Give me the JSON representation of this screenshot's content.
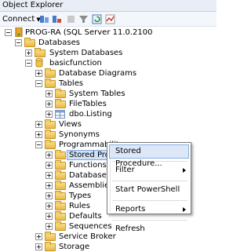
{
  "window": {
    "title": "Object Explorer"
  },
  "toolbar": {
    "connect_label": "Connect"
  },
  "tree": {
    "server": "PROG-RA (SQL Server 11.0.2100",
    "databases": "Databases",
    "system_databases": "System Databases",
    "basicfunction": "basicfunction",
    "database_diagrams": "Database Diagrams",
    "tables": "Tables",
    "system_tables": "System Tables",
    "filetables": "FileTables",
    "dbo_listing": "dbo.Listing",
    "views": "Views",
    "synonyms": "Synonyms",
    "programmability": "Programmability",
    "stored_procedures": "Stored Procedu",
    "functions": "Functions",
    "database_triggers": "Database Tr",
    "assemblies": "Assemblies",
    "types": "Types",
    "rules": "Rules",
    "defaults": "Defaults",
    "sequences": "Sequences",
    "service_broker": "Service Broker",
    "storage": "Storage"
  },
  "context_menu": {
    "items": [
      {
        "label": "Stored Procedure..."
      },
      {
        "label": "Filter"
      },
      {
        "label": "Start PowerShell"
      },
      {
        "label": "Reports"
      },
      {
        "label": "Refresh"
      }
    ]
  },
  "colors": {
    "selection": "#cfe0f7",
    "folder": "#e9b844"
  }
}
